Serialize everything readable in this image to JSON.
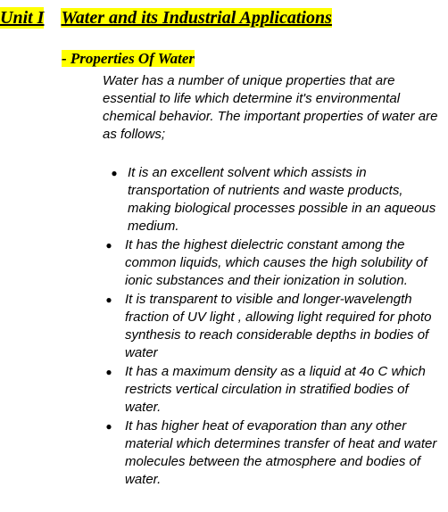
{
  "unit": {
    "label": "Unit I",
    "title": "Water and its Industrial Applications"
  },
  "section": {
    "title": "- Properties Of Water"
  },
  "intro": "Water has a number of unique properties that are essential to life which determine it's environmental chemical behavior. The important properties of water are as follows;",
  "bullet_symbol": "●",
  "bullets": [
    "It is an excellent solvent which assists in transportation of nutrients and waste products, making biological processes possible in an aqueous medium.",
    "It has the highest dielectric constant among the common liquids, which causes the high solubility of ionic substances and their ionization in solution.",
    "It is transparent to visible and longer-wavelength fraction of UV light , allowing light required for photo synthesis to reach considerable depths in bodies of water",
    "It has a maximum density as a liquid at 4o C which restricts vertical circulation in stratified bodies of water.",
    "It has higher heat of evaporation than any other material which determines transfer of heat and water molecules between the atmosphere and bodies of water."
  ]
}
